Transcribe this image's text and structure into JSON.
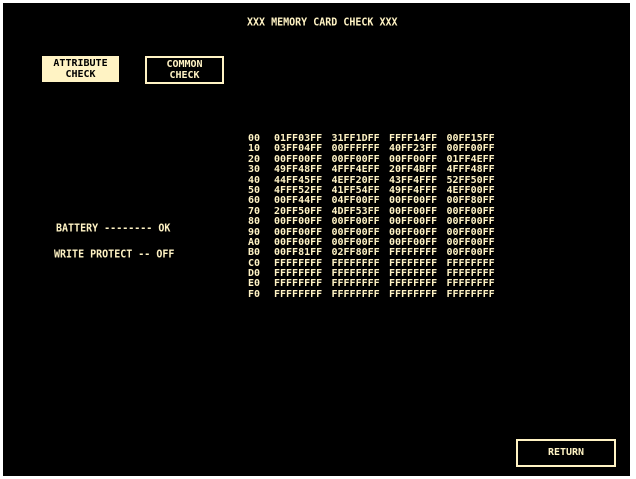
{
  "header": {
    "title": "XXX MEMORY CARD CHECK XXX"
  },
  "buttons": {
    "attribute_check": "ATTRIBUTE\nCHECK",
    "common_check": "COMMON\nCHECK",
    "return": "RETURN"
  },
  "status": {
    "battery": "BATTERY -------- OK",
    "write_protect": "WRITE PROTECT -- OFF"
  },
  "memory_dump": {
    "rows": [
      {
        "addr": "00",
        "cells": [
          "01FF03FF",
          "31FF1DFF",
          "FFFF14FF",
          "00FF15FF"
        ]
      },
      {
        "addr": "10",
        "cells": [
          "03FF04FF",
          "00FFFFFF",
          "40FF23FF",
          "00FF00FF"
        ]
      },
      {
        "addr": "20",
        "cells": [
          "00FF00FF",
          "00FF00FF",
          "00FF00FF",
          "01FF4EFF"
        ]
      },
      {
        "addr": "30",
        "cells": [
          "49FF48FF",
          "4FFF4EFF",
          "20FF4BFF",
          "4FFF48FF"
        ]
      },
      {
        "addr": "40",
        "cells": [
          "44FF45FF",
          "4EFF20FF",
          "43FF4FFF",
          "52FF50FF"
        ]
      },
      {
        "addr": "50",
        "cells": [
          "4FFF52FF",
          "41FF54FF",
          "49FF4FFF",
          "4EFF00FF"
        ]
      },
      {
        "addr": "60",
        "cells": [
          "00FF44FF",
          "04FF00FF",
          "00FF00FF",
          "00FF80FF"
        ]
      },
      {
        "addr": "70",
        "cells": [
          "20FF50FF",
          "4DFF53FF",
          "00FF00FF",
          "00FF00FF"
        ]
      },
      {
        "addr": "80",
        "cells": [
          "00FF00FF",
          "00FF00FF",
          "00FF00FF",
          "00FF00FF"
        ]
      },
      {
        "addr": "90",
        "cells": [
          "00FF00FF",
          "00FF00FF",
          "00FF00FF",
          "00FF00FF"
        ]
      },
      {
        "addr": "A0",
        "cells": [
          "00FF00FF",
          "00FF00FF",
          "00FF00FF",
          "00FF00FF"
        ]
      },
      {
        "addr": "B0",
        "cells": [
          "00FF81FF",
          "02FF80FF",
          "FFFFFFFF",
          "00FF00FF"
        ]
      },
      {
        "addr": "C0",
        "cells": [
          "FFFFFFFF",
          "FFFFFFFF",
          "FFFFFFFF",
          "FFFFFFFF"
        ]
      },
      {
        "addr": "D0",
        "cells": [
          "FFFFFFFF",
          "FFFFFFFF",
          "FFFFFFFF",
          "FFFFFFFF"
        ]
      },
      {
        "addr": "E0",
        "cells": [
          "FFFFFFFF",
          "FFFFFFFF",
          "FFFFFFFF",
          "FFFFFFFF"
        ]
      },
      {
        "addr": "F0",
        "cells": [
          "FFFFFFFF",
          "FFFFFFFF",
          "FFFFFFFF",
          "FFFFFFFF"
        ]
      }
    ]
  },
  "colors": {
    "background": "#000000",
    "text": "#fff3c4",
    "frame": "#ffffff"
  }
}
